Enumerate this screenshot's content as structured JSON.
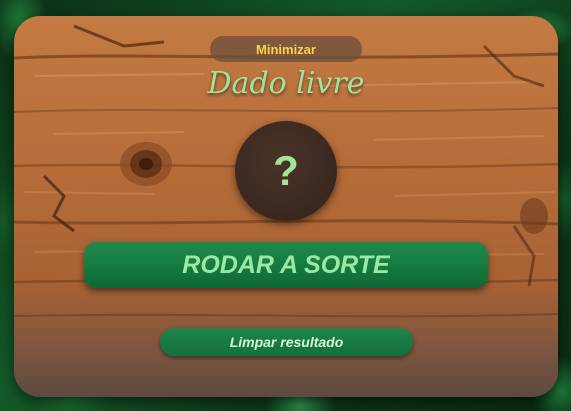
{
  "panel": {
    "minimize_label": "Minimizar",
    "title": "Dado livre",
    "dice_result": "?",
    "roll_label": "RODAR A SORTE",
    "clear_label": "Limpar resultado"
  },
  "colors": {
    "title_green": "#9fe3a0",
    "button_green": "#157a40",
    "minimize_text": "#f7d44a",
    "dice_bg": "#3a2820",
    "wood_base": "#b36a3a"
  }
}
